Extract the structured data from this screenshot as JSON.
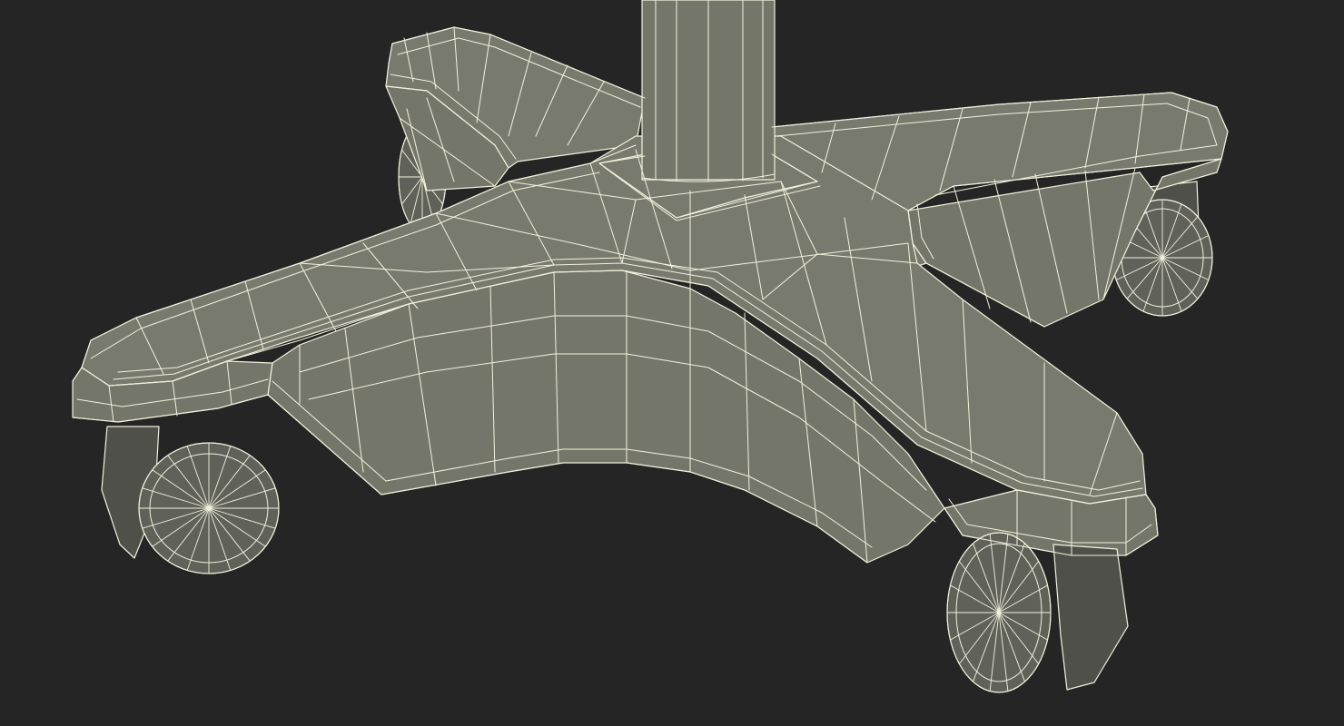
{
  "colors": {
    "background": "#252525",
    "surface": "#75766a",
    "surface_top": "#787a6e",
    "surface_dark": "#60625a",
    "surface_shadow": "#4f5049",
    "wire": "#f2f1dc"
  },
  "subject": {
    "leg_count": 5,
    "caster_count": 4
  }
}
